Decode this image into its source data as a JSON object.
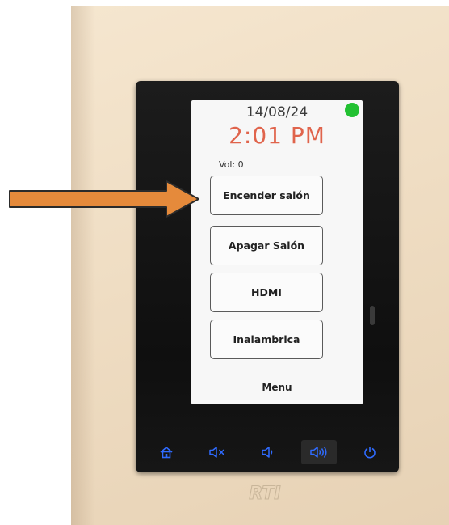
{
  "device": {
    "date": "14/08/24",
    "time": "2:01 PM",
    "volume_label": "Vol: 0",
    "status_color": "#22c132",
    "time_color": "#e0644c",
    "accent_color": "#2f6bff",
    "arrow_color": "#e58a3b"
  },
  "buttons": [
    {
      "label": "Encender salón"
    },
    {
      "label": "Apagar Salón"
    },
    {
      "label": "HDMI"
    },
    {
      "label": "Inalambrica"
    }
  ],
  "menu_label": "Menu",
  "hardware_keys": [
    "home-icon",
    "mute-icon",
    "volume-down-icon",
    "volume-up-icon",
    "power-icon"
  ],
  "brand": "RTI"
}
